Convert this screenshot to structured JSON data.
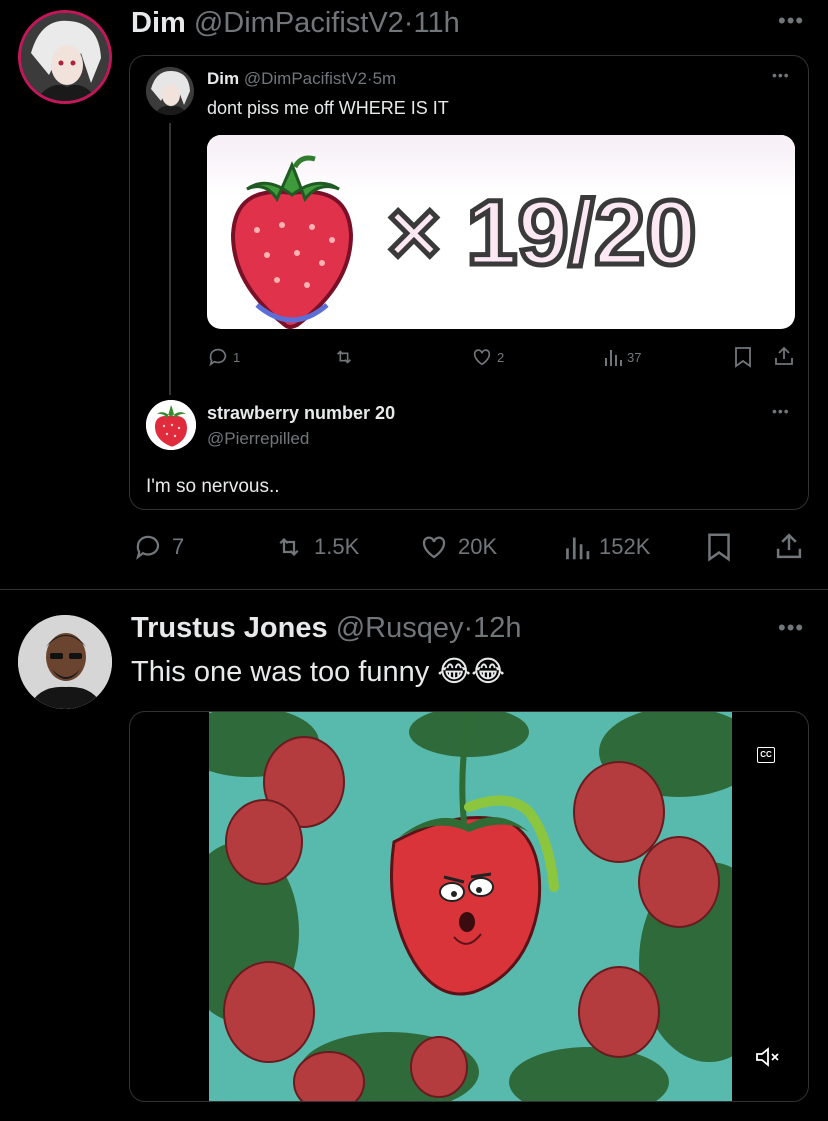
{
  "tweet1": {
    "display_name": "Dim",
    "handle": "@DimPacifistV2",
    "time": "11h",
    "quote": {
      "display_name": "Dim",
      "handle": "@DimPacifistV2",
      "time": "5m",
      "text": "dont piss me off WHERE IS IT",
      "image_text": "× 19/20",
      "stats": {
        "replies": "1",
        "likes": "2",
        "views": "37"
      },
      "reply": {
        "display_name": "strawberry number 20",
        "handle": "@Pierrepilled",
        "text": "I'm so nervous.."
      }
    },
    "stats": {
      "replies": "7",
      "reposts": "1.5K",
      "likes": "20K",
      "views": "152K"
    }
  },
  "tweet2": {
    "display_name": "Trustus Jones",
    "handle": "@Rusqey",
    "time": "12h",
    "text": "This one was too funny 😂😂",
    "video": {
      "cc_label": "CC"
    }
  },
  "colors": {
    "background": "#000000",
    "text": "#e7e9ea",
    "muted": "#71767b",
    "border": "#2f3336"
  }
}
